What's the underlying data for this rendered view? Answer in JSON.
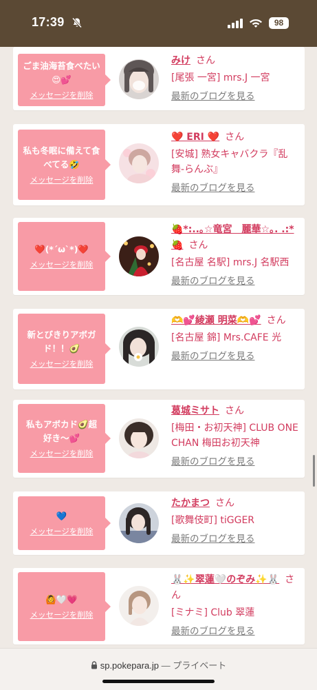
{
  "status": {
    "time": "17:39",
    "battery": "98"
  },
  "common": {
    "delete_label": "メッセージを削除",
    "san": "さん",
    "blog_link": "最新のブログを見る"
  },
  "cards": [
    {
      "message": "ごま油海苔食べたい😍💕",
      "name": "みけ",
      "shop": "[尾張 一宮] mrs.J 一宮"
    },
    {
      "message": "私も冬眠に備えて食べてる🤣",
      "name": "❤️ ERI ❤️",
      "shop": "[安城] 熟女キャバクラ『乱舞-らんぶ』"
    },
    {
      "message": "❤️(*´ω`*)❤️",
      "name": "🍓*:..｡☆竜宮　麗華☆｡. .:*🍓",
      "shop": "[名古屋 名駅] mrs.J 名駅西"
    },
    {
      "message": "新とびきりアボガド！！🥑",
      "name": "🫶💕綾瀬 明菜🫶💕",
      "shop": "[名古屋 錦] Mrs.CAFE 光"
    },
    {
      "message": "私もアボカド🥑超好き〜💕",
      "name": "葛城ミサト",
      "shop": "[梅田・お初天神] CLUB ONE CHAN 梅田お初天神"
    },
    {
      "message": "💙",
      "name": "たかまつ",
      "shop": "[歌舞伎町] tiGGER"
    },
    {
      "message": "🙆🤍💗",
      "name": "🐰✨翠蓮🤍のぞみ✨🐰",
      "shop": "[ミナミ] Club 翠蓮"
    }
  ],
  "browser": {
    "domain": "sp.pokepara.jp",
    "separator": "—",
    "mode": "プライベート"
  }
}
